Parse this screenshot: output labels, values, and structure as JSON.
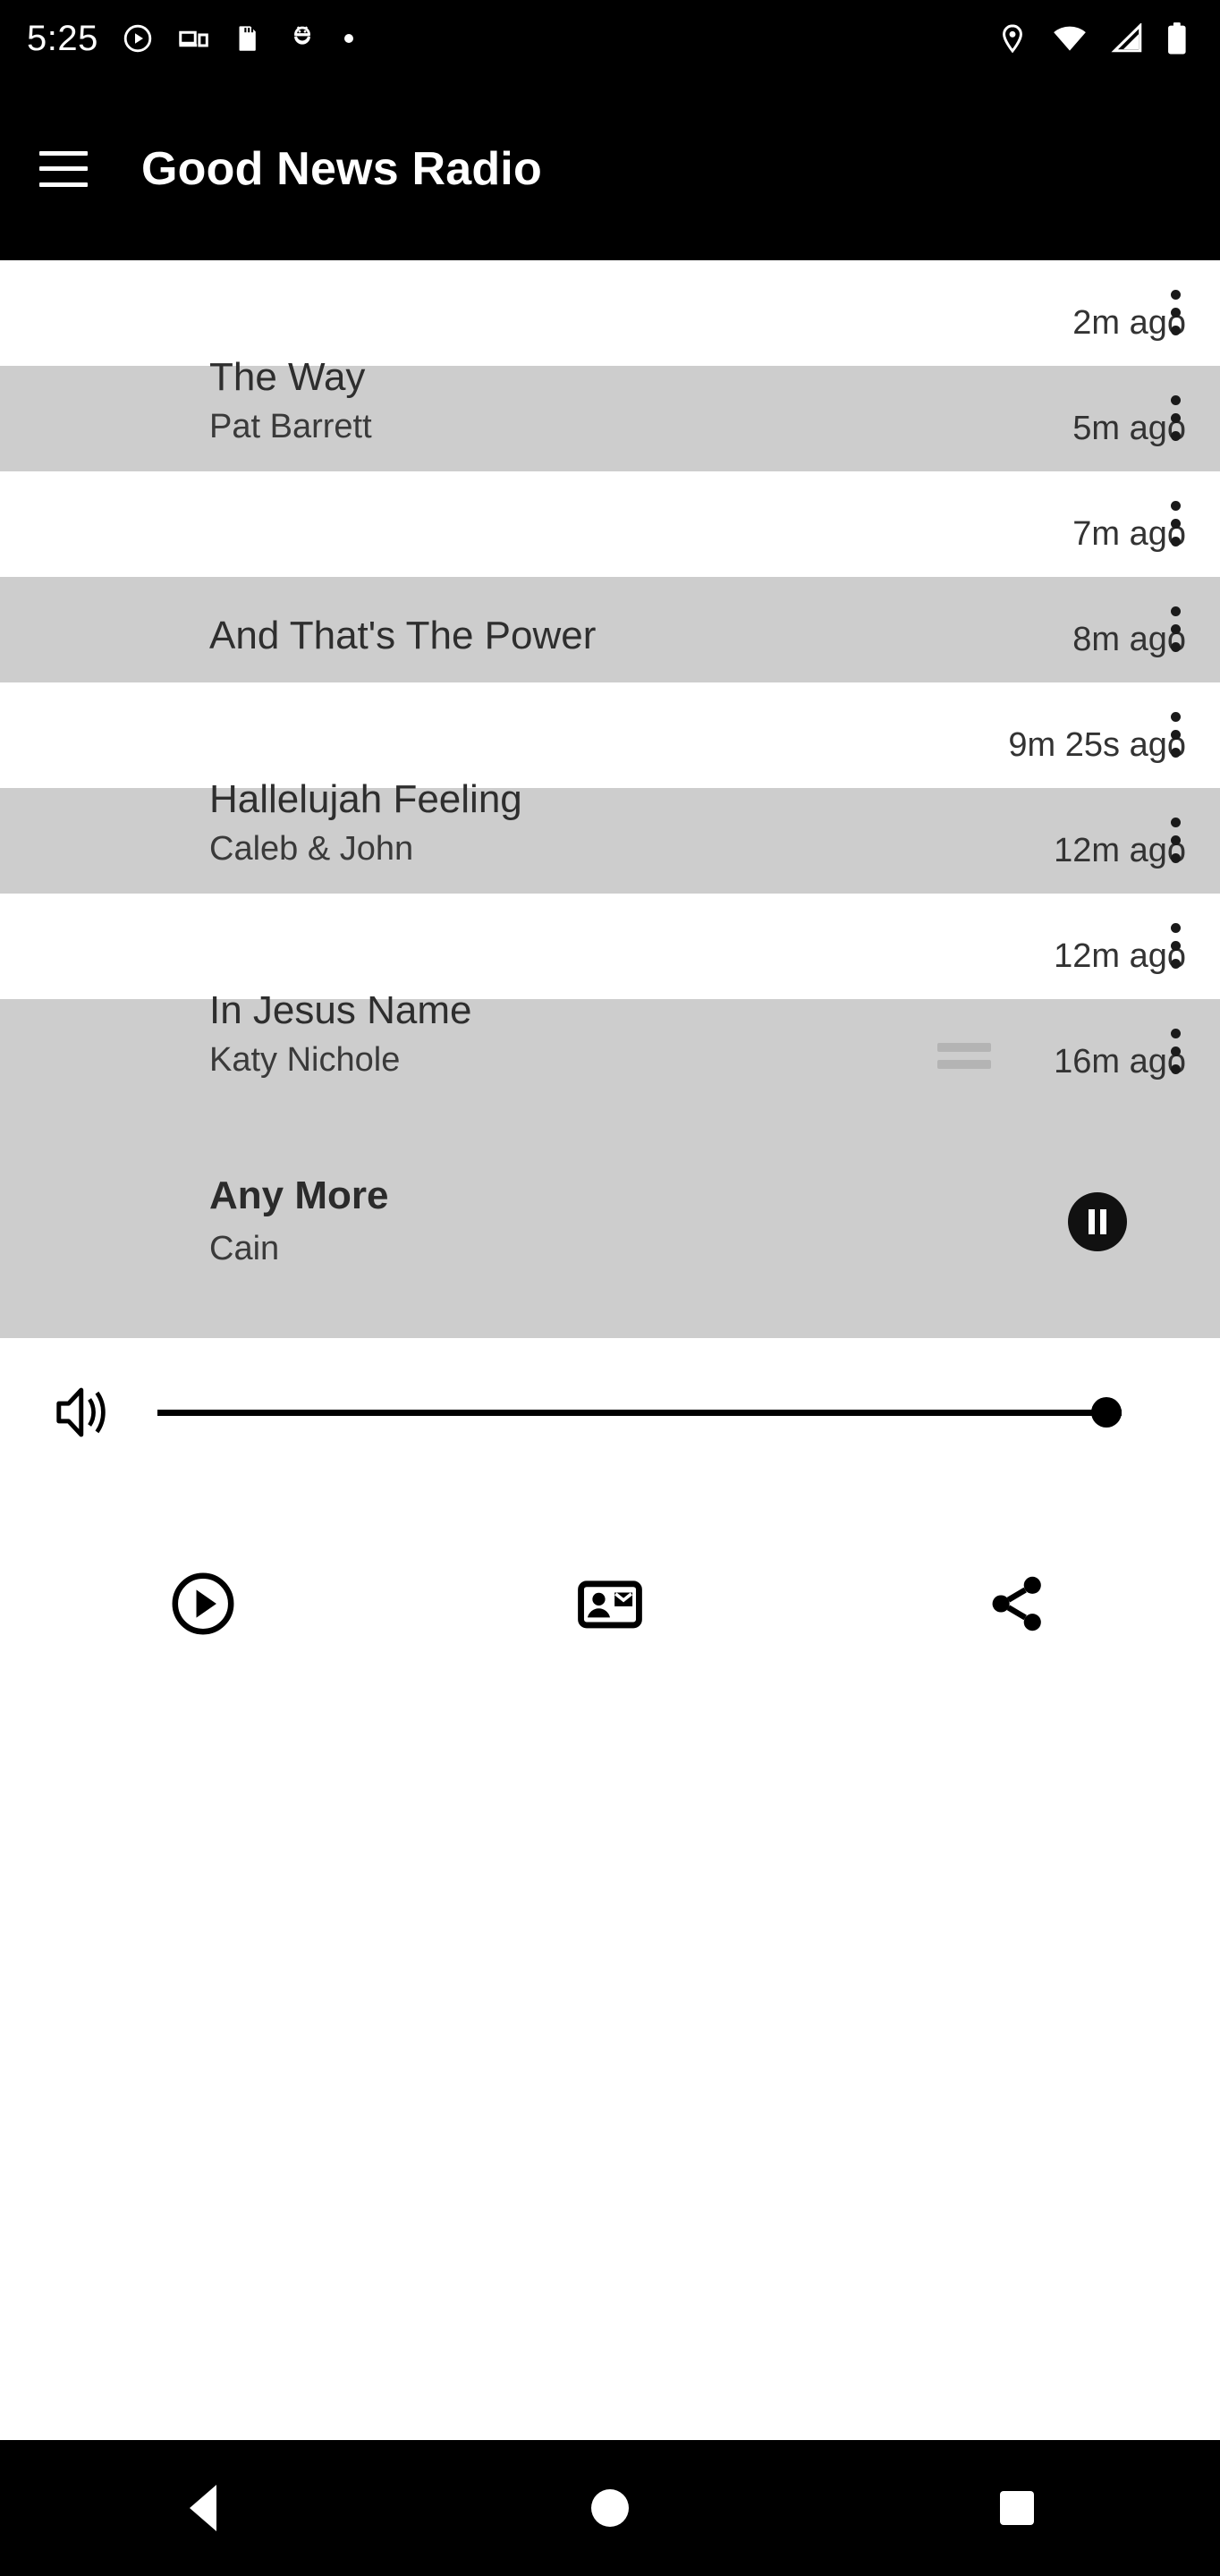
{
  "statusbar": {
    "time": "5:25",
    "left_icons": [
      "play-circle-icon",
      "cast-devices-icon",
      "sd-card-icon",
      "android-debug-icon",
      "dot-icon"
    ],
    "right_icons": [
      "location-pin-icon",
      "wifi-icon",
      "cell-signal-icon",
      "battery-icon"
    ]
  },
  "appbar": {
    "menu_icon": "hamburger-menu-icon",
    "title": "Good News Radio"
  },
  "list": [
    {
      "title": "",
      "artist": "",
      "time": "2m ago",
      "shade": false
    },
    {
      "title": "The Way",
      "artist": "Pat Barrett",
      "time": "5m ago",
      "shade": true
    },
    {
      "title": "",
      "artist": "",
      "time": "7m ago",
      "shade": false
    },
    {
      "title": "And That's The Power",
      "artist": "",
      "time": "8m ago",
      "shade": true
    },
    {
      "title": "",
      "artist": "",
      "time": "9m 25s ago",
      "shade": false
    },
    {
      "title": "Hallelujah Feeling",
      "artist": "Caleb & John",
      "time": "12m ago",
      "shade": true
    },
    {
      "title": "",
      "artist": "",
      "time": "12m ago",
      "shade": false
    },
    {
      "title": "In Jesus Name",
      "artist": "Katy Nichole",
      "time": "16m ago",
      "shade": true
    }
  ],
  "now_playing": {
    "title": "Any More",
    "artist": "Cain",
    "state": "playing",
    "button_icon": "pause-icon"
  },
  "volume": {
    "icon": "volume-up-icon",
    "level": 100
  },
  "actions": [
    {
      "icon": "play-circle-outline-icon",
      "label": "Play"
    },
    {
      "icon": "contact-mail-icon",
      "label": "Contact"
    },
    {
      "icon": "share-icon",
      "label": "Share"
    }
  ],
  "navbar": {
    "back": "back-triangle-icon",
    "home": "home-circle-icon",
    "recents": "recents-square-icon"
  },
  "colors": {
    "bar_background": "#000000",
    "row_shade": "#cdcdcd",
    "row_light": "#ffffff",
    "text_primary": "#2e2e2e",
    "accent": "#111111"
  }
}
